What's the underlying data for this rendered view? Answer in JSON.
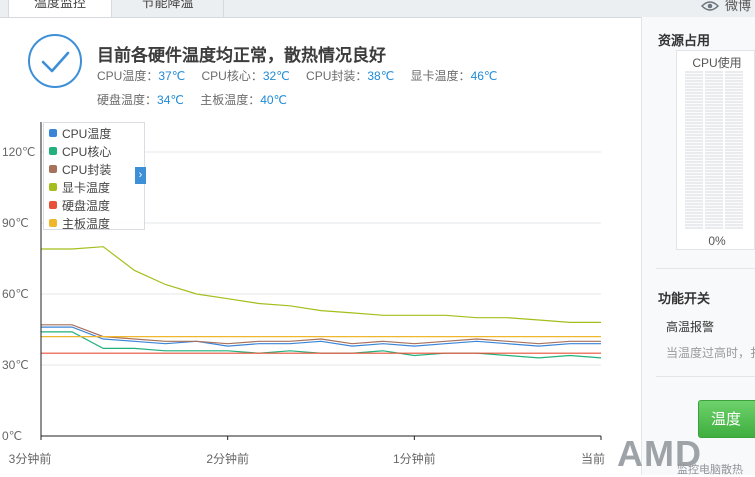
{
  "tabs": [
    {
      "label": "温度监控",
      "active": true
    },
    {
      "label": "节能降温",
      "active": false
    }
  ],
  "top_right": {
    "label": "微博",
    "icon": "eye-icon"
  },
  "status": {
    "title": "目前各硬件温度均正常，散热情况良好",
    "icon": "check-circle-icon",
    "row1": [
      {
        "label": "CPU温度：",
        "value": "37℃"
      },
      {
        "label": "CPU核心：",
        "value": "32℃"
      },
      {
        "label": "CPU封装：",
        "value": "38℃"
      },
      {
        "label": "显卡温度：",
        "value": "46℃"
      }
    ],
    "row2": [
      {
        "label": "硬盘温度：",
        "value": "34℃"
      },
      {
        "label": "主板温度：",
        "value": "40℃"
      }
    ]
  },
  "chart_data": {
    "type": "line",
    "title": "",
    "xlabel": "",
    "ylabel": "",
    "ylim": [
      0,
      120
    ],
    "yticks": [
      "120℃",
      "90℃",
      "60℃",
      "30℃",
      "0℃"
    ],
    "yticks_values": [
      120,
      90,
      60,
      30,
      0
    ],
    "xticks": [
      "3分钟前",
      "2分钟前",
      "1分钟前",
      "当前"
    ],
    "x_minutes_ago": [
      3,
      2,
      1,
      0
    ],
    "grid": true,
    "legend_position": "top-left",
    "x": [
      180,
      170,
      160,
      150,
      140,
      130,
      120,
      110,
      100,
      90,
      80,
      70,
      60,
      50,
      40,
      30,
      20,
      10,
      0
    ],
    "series": [
      {
        "name": "CPU温度",
        "color": "#3a85d8",
        "values": [
          46,
          46,
          41,
          40,
          39,
          40,
          38,
          39,
          39,
          40,
          38,
          39,
          38,
          39,
          40,
          39,
          38,
          39,
          39
        ]
      },
      {
        "name": "CPU核心",
        "color": "#22b07c",
        "values": [
          44,
          44,
          37,
          37,
          36,
          36,
          36,
          35,
          36,
          35,
          35,
          36,
          34,
          35,
          35,
          34,
          33,
          34,
          33
        ]
      },
      {
        "name": "CPU封装",
        "color": "#a8715a",
        "values": [
          47,
          47,
          42,
          41,
          40,
          40,
          39,
          40,
          40,
          41,
          39,
          40,
          39,
          40,
          41,
          40,
          39,
          40,
          40
        ]
      },
      {
        "name": "显卡温度",
        "color": "#a5be1b",
        "values": [
          79,
          79,
          80,
          70,
          64,
          60,
          58,
          56,
          55,
          53,
          52,
          51,
          51,
          51,
          50,
          50,
          49,
          48,
          48
        ]
      },
      {
        "name": "硬盘温度",
        "color": "#e8503a",
        "values": [
          35,
          35,
          35,
          35,
          35,
          35,
          35,
          35,
          35,
          35,
          35,
          35,
          35,
          35,
          35,
          35,
          35,
          35,
          35
        ]
      },
      {
        "name": "主板温度",
        "color": "#f0b72c",
        "values": [
          42,
          42,
          42,
          42,
          42,
          42,
          42,
          42,
          42,
          42,
          42,
          42,
          42,
          42,
          42,
          42,
          42,
          42,
          42
        ]
      }
    ]
  },
  "right_panel": {
    "resource_title": "资源占用",
    "cpu_caption": "CPU使用",
    "cpu_percent": "0%",
    "cpu_usage": 0,
    "function_title": "功能开关",
    "option_label": "高温报警",
    "option_desc": "当温度过高时，扌",
    "button_label": "温度"
  },
  "watermark": {
    "logo_text": "AMD",
    "caption": "监控电脑散热"
  },
  "colors": {
    "accent": "#3d8fd8",
    "value_blue": "#1f8ad6",
    "green_button": "#4dbf4c"
  }
}
